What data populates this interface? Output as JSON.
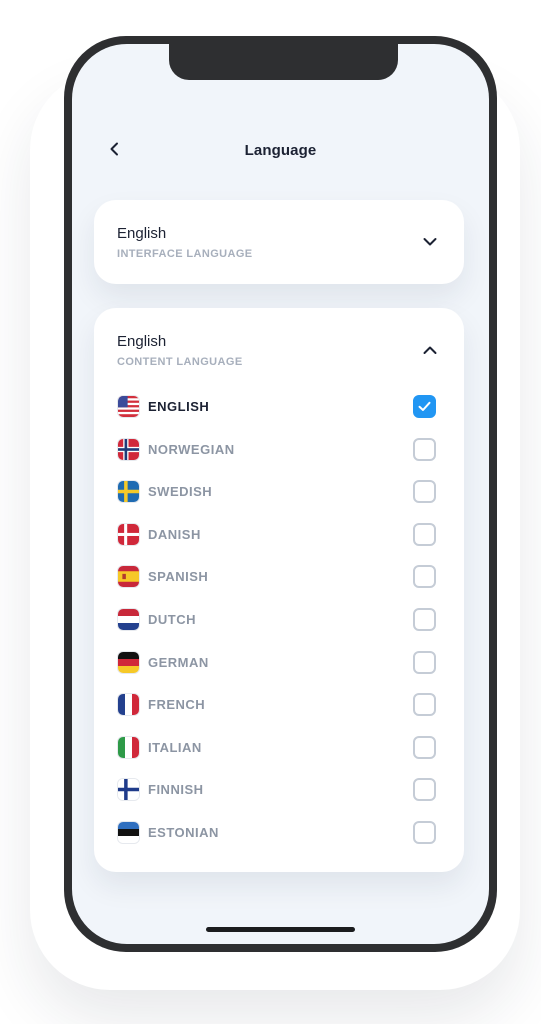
{
  "header": {
    "title": "Language"
  },
  "interface_language": {
    "value": "English",
    "caption": "INTERFACE LANGUAGE",
    "expanded": false
  },
  "content_language": {
    "value": "English",
    "caption": "CONTENT LANGUAGE",
    "expanded": true,
    "options": [
      {
        "label": "ENGLISH",
        "flag": "us-flag-icon",
        "checked": true
      },
      {
        "label": "NORWEGIAN",
        "flag": "no-flag-icon",
        "checked": false
      },
      {
        "label": "SWEDISH",
        "flag": "se-flag-icon",
        "checked": false
      },
      {
        "label": "DANISH",
        "flag": "dk-flag-icon",
        "checked": false
      },
      {
        "label": "SPANISH",
        "flag": "es-flag-icon",
        "checked": false
      },
      {
        "label": "DUTCH",
        "flag": "nl-flag-icon",
        "checked": false
      },
      {
        "label": "GERMAN",
        "flag": "de-flag-icon",
        "checked": false
      },
      {
        "label": "FRENCH",
        "flag": "fr-flag-icon",
        "checked": false
      },
      {
        "label": "ITALIAN",
        "flag": "it-flag-icon",
        "checked": false
      },
      {
        "label": "FINNISH",
        "flag": "fi-flag-icon",
        "checked": false
      },
      {
        "label": "ESTONIAN",
        "flag": "ee-flag-icon",
        "checked": false
      }
    ]
  },
  "colors": {
    "accent": "#2196f3",
    "background": "#f1f5fa",
    "text_primary": "#1c2233",
    "text_secondary": "#8c95a3"
  }
}
